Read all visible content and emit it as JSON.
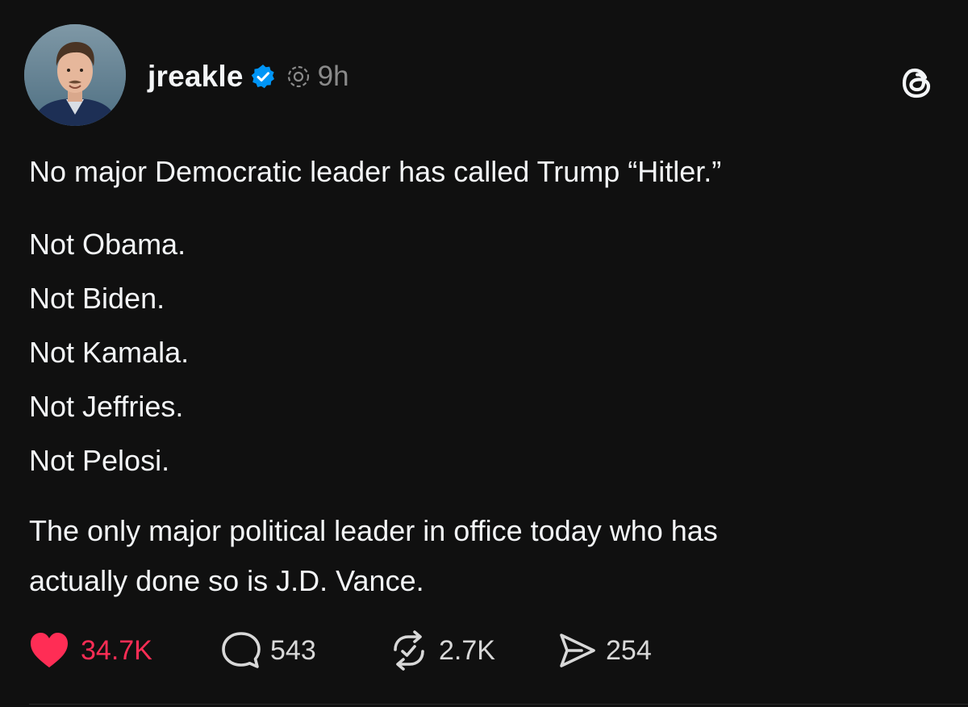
{
  "post": {
    "username": "jreakle",
    "time": "9h",
    "lines": [
      "No major Democratic leader has called Trump “Hitler.”",
      "Not Obama.",
      "Not Biden.",
      "Not Kamala.",
      "Not Jeffries.",
      "Not Pelosi.",
      "The only major political leader in office today who has",
      "actually done so is J.D. Vance."
    ]
  },
  "actions": {
    "likes": "34.7K",
    "replies": "543",
    "reposts": "2.7K",
    "shares": "254"
  },
  "icons": {
    "verified": "verified-badge-icon",
    "via": "threads-via-icon",
    "logo": "threads-logo-icon",
    "like": "heart-icon",
    "reply": "speech-bubble-icon",
    "repost": "repost-icon",
    "share": "send-icon"
  },
  "colors": {
    "background": "#101010",
    "text": "#f3f5f7",
    "muted": "#8a8a8a",
    "verified": "#0095f6",
    "liked": "#ff2d55"
  }
}
